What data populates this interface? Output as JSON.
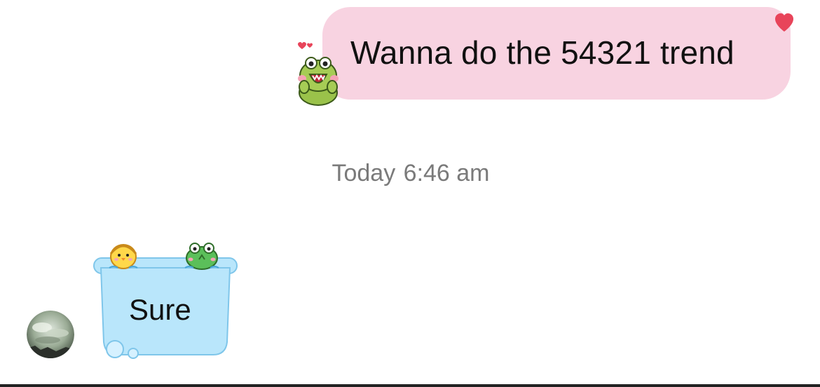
{
  "conversation": {
    "outgoing_message": {
      "text": "Wanna do the 54321 trend",
      "bubble_color": "#f8d3e1",
      "reaction": "heart-icon",
      "sticker": "frog-sticker-icon"
    },
    "timestamp": {
      "day": "Today",
      "time": "6:46 am"
    },
    "incoming_message": {
      "text": "Sure",
      "bubble_color": "#b9e6fb",
      "sticker": "bath-tub-bubble-icon",
      "avatar": "avatar-icon"
    }
  },
  "colors": {
    "heart": "#e8445a",
    "timestamp_text": "#7a7a7a",
    "bubble_outline_blue": "#7fc6ea"
  }
}
